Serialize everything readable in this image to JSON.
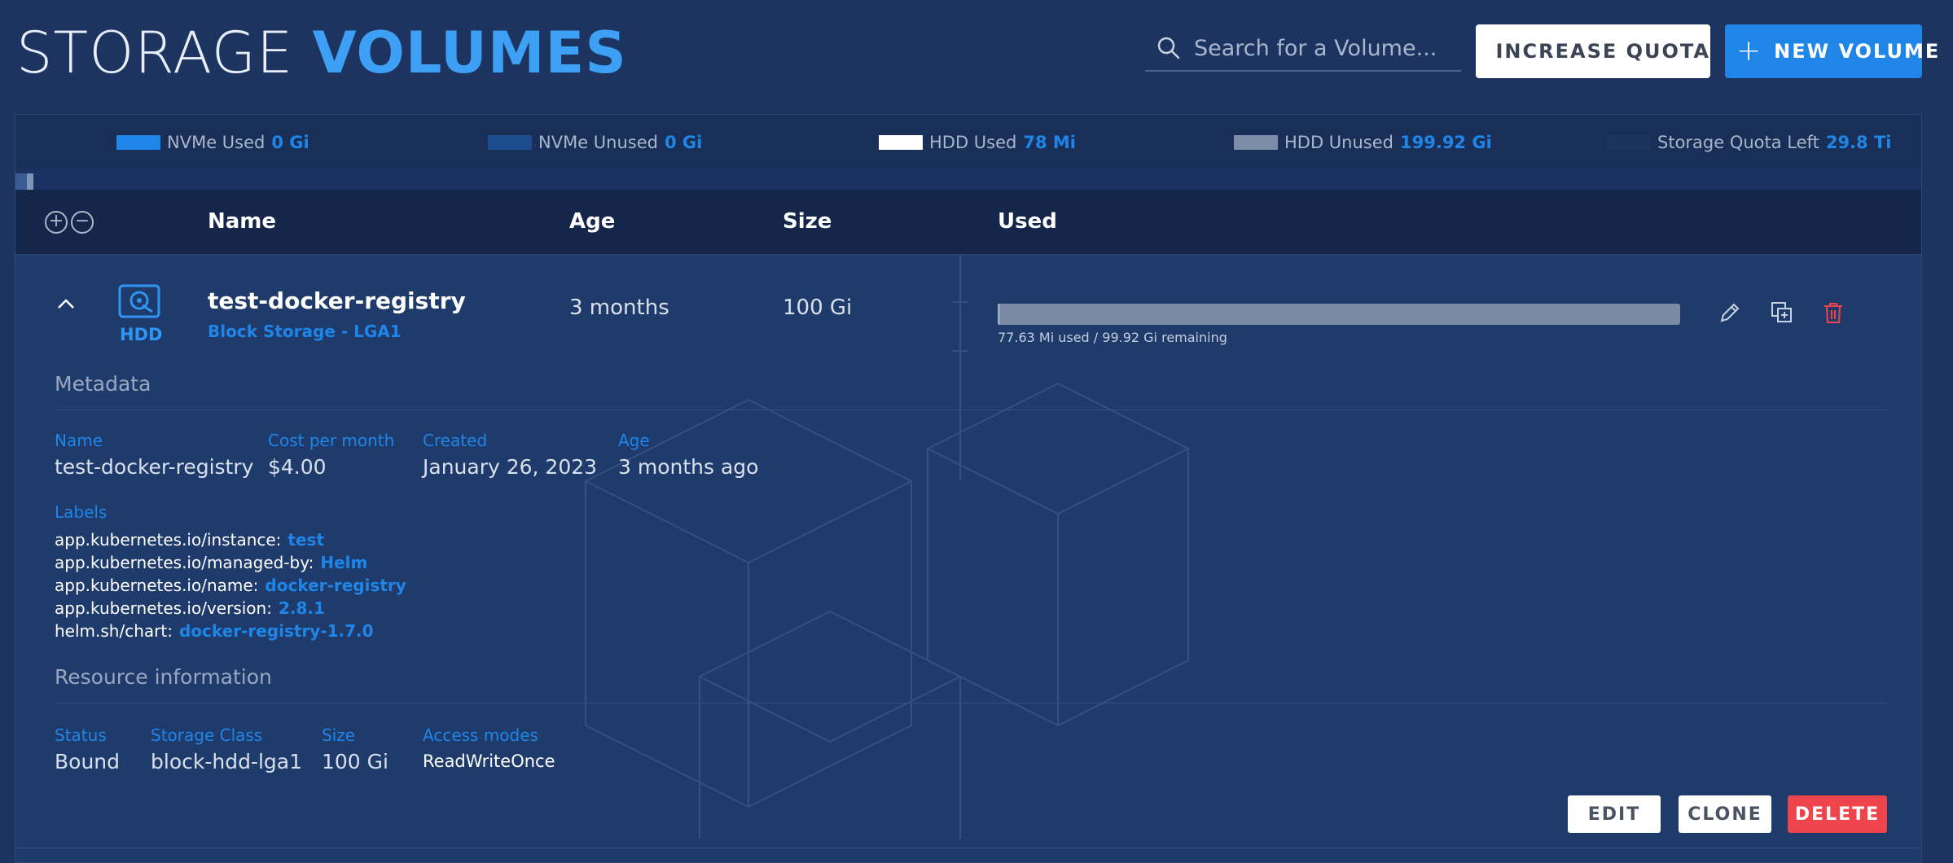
{
  "header": {
    "title_light": "STORAGE",
    "title_bold": "VOLUMES",
    "search_placeholder": "Search for a Volume...",
    "increase_quota_label": "INCREASE QUOTA",
    "new_volume_label": "NEW VOLUME"
  },
  "legend": [
    {
      "label": "NVMe Used",
      "value": "0 Gi",
      "color": "#1f86e8"
    },
    {
      "label": "NVMe Unused",
      "value": "0 Gi",
      "color": "#1e4d8f"
    },
    {
      "label": "HDD Used",
      "value": "78 Mi",
      "color": "#ffffff"
    },
    {
      "label": "HDD Unused",
      "value": "199.92 Gi",
      "color": "#7d8da8"
    },
    {
      "label": "Storage Quota Left",
      "value": "29.8 Ti",
      "color": "#1b335d"
    }
  ],
  "table": {
    "columns": {
      "name": "Name",
      "age": "Age",
      "size": "Size",
      "used": "Used"
    },
    "row": {
      "type": "HDD",
      "name": "test-docker-registry",
      "subtitle": "Block Storage - LGA1",
      "age": "3 months",
      "size": "100 Gi",
      "used_text": "77.63 Mi used / 99.92 Gi remaining",
      "used_fraction": 0.0008
    }
  },
  "metadata": {
    "heading": "Metadata",
    "fields": [
      {
        "label": "Name",
        "value": "test-docker-registry"
      },
      {
        "label": "Cost per month",
        "value": "$4.00"
      },
      {
        "label": "Created",
        "value": "January 26, 2023"
      },
      {
        "label": "Age",
        "value": "3 months ago"
      }
    ],
    "labels_heading": "Labels",
    "labels": [
      {
        "key": "app.kubernetes.io/instance:",
        "value": "test"
      },
      {
        "key": "app.kubernetes.io/managed-by:",
        "value": "Helm"
      },
      {
        "key": "app.kubernetes.io/name:",
        "value": "docker-registry"
      },
      {
        "key": "app.kubernetes.io/version:",
        "value": "2.8.1"
      },
      {
        "key": "helm.sh/chart:",
        "value": "docker-registry-1.7.0"
      }
    ]
  },
  "resource": {
    "heading": "Resource information",
    "fields": [
      {
        "label": "Status",
        "value": "Bound"
      },
      {
        "label": "Storage Class",
        "value": "block-hdd-lga1"
      },
      {
        "label": "Size",
        "value": "100 Gi"
      },
      {
        "label": "Access modes",
        "value": "ReadWriteOnce"
      }
    ]
  },
  "actions": {
    "edit": "EDIT",
    "clone": "CLONE",
    "delete": "DELETE"
  },
  "colors": {
    "accent": "#1f86e8",
    "danger": "#f0444d",
    "background": "#1d3461"
  }
}
